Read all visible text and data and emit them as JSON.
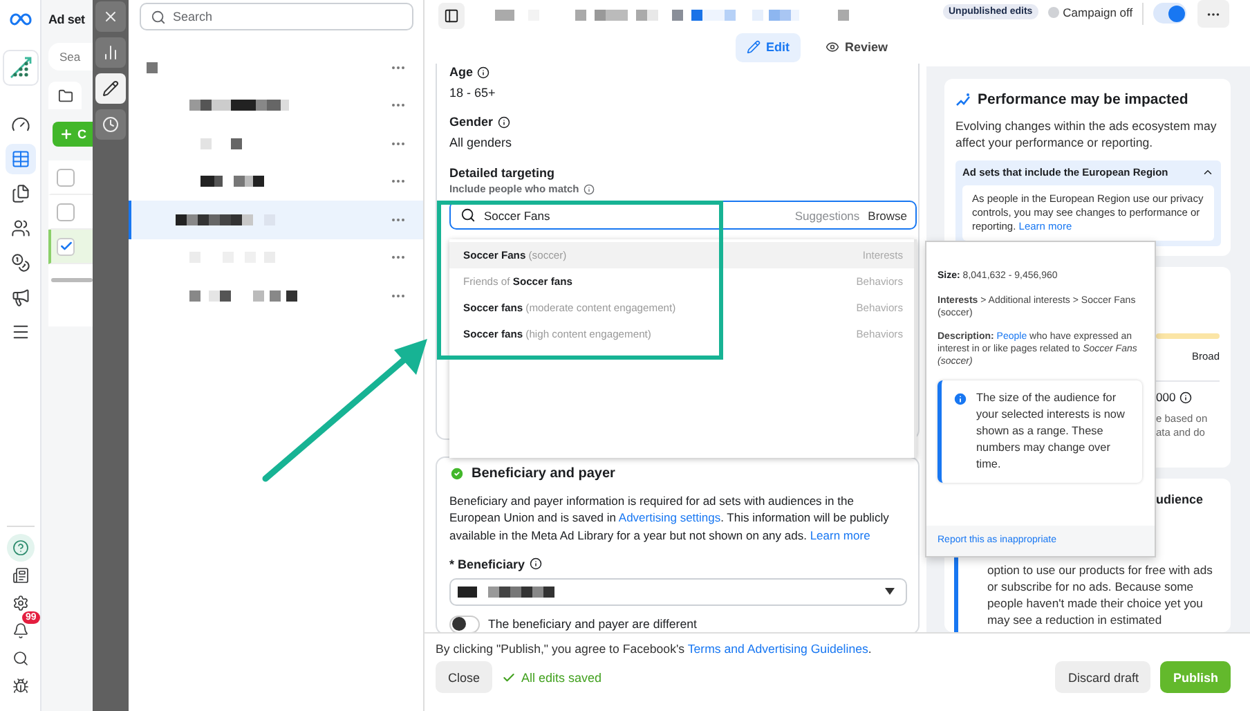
{
  "nav_rail": {
    "top": [
      {
        "kind": "logo",
        "selected": false
      },
      {
        "kind": "app",
        "selected": false
      },
      {
        "kind": "gauge",
        "selected": false
      },
      {
        "kind": "table",
        "selected": true
      },
      {
        "kind": "pages",
        "selected": false
      },
      {
        "kind": "people",
        "selected": false
      },
      {
        "kind": "coins",
        "selected": false
      },
      {
        "kind": "megaphone",
        "selected": false
      },
      {
        "kind": "menu",
        "selected": false
      }
    ],
    "bottom": [
      {
        "kind": "help",
        "selected": false
      },
      {
        "kind": "news",
        "selected": false
      },
      {
        "kind": "settings",
        "selected": false
      },
      {
        "kind": "bell",
        "selected": false,
        "badge": "99"
      },
      {
        "kind": "search",
        "selected": false
      },
      {
        "kind": "bug",
        "selected": false
      }
    ]
  },
  "ad_sets_panel": {
    "title": "Ad set",
    "search_placeholder": "Sea",
    "create_button": "C",
    "rows": [
      {
        "checked": false
      },
      {
        "checked": false
      },
      {
        "checked": true
      }
    ]
  },
  "tool_strip": [
    {
      "kind": "close",
      "selected": false
    },
    {
      "kind": "chart",
      "selected": false
    },
    {
      "kind": "edit",
      "selected": true
    },
    {
      "kind": "history",
      "selected": false
    }
  ],
  "tree": {
    "search_placeholder": "Search",
    "rows": [
      {
        "selected": false
      },
      {
        "selected": false
      },
      {
        "selected": false
      },
      {
        "selected": false
      },
      {
        "selected": true
      },
      {
        "selected": false
      },
      {
        "selected": false
      }
    ]
  },
  "editor": {
    "tabs": [
      {
        "label": "Edit",
        "selected": true
      },
      {
        "label": "Review",
        "selected": false
      }
    ],
    "age": {
      "label": "Age",
      "value": "18 - 65+"
    },
    "gender": {
      "label": "Gender",
      "value": "All genders"
    },
    "detailed_targeting": {
      "label": "Detailed targeting",
      "sublabel": "Include people who match",
      "search_value": "Soccer Fans",
      "suggestions_label": "Suggestions",
      "browse_label": "Browse"
    },
    "suggestions": [
      {
        "text": "**Soccer Fans** (soccer)",
        "category": "Interests",
        "selected": true
      },
      {
        "text": "Friends of **Soccer fans**",
        "category": "Behaviors",
        "selected": false
      },
      {
        "text": "**Soccer fans** (moderate content engagement)",
        "category": "Behaviors",
        "selected": false
      },
      {
        "text": "**Soccer fans** (high content engagement)",
        "category": "Behaviors",
        "selected": false
      }
    ],
    "beneficiary_section": {
      "title": "Beneficiary and payer",
      "description": [
        {
          "kind": "text",
          "text": "Beneficiary and payer information is required for ad sets with audiences in the European Union and is saved in "
        },
        {
          "kind": "link",
          "text": "Advertising settings"
        },
        {
          "kind": "text",
          "text": ". This information will be publicly available in the Meta Ad Library for a year but not shown on any ads. "
        },
        {
          "kind": "link",
          "text": "Learn more"
        }
      ],
      "beneficiary_label": "* Beneficiary",
      "payer_toggle": {
        "label": "The beneficiary and payer are different",
        "on": false
      }
    }
  },
  "header_status": {
    "badge": "Unpublished edits",
    "campaign_status": "Campaign off",
    "campaign_toggle_on": true
  },
  "right_panel": {
    "performance_card": {
      "title": "Performance may be impacted",
      "body": "Evolving changes within the ads ecosystem may affect your performance or reporting.",
      "accordion": {
        "title": "Ad sets that include the European Region",
        "expanded": true,
        "body": "As people in the European Region use our privacy controls, you may see changes to performance or reporting. ",
        "link": "Learn more"
      }
    },
    "audience_card": {
      "range_end": "Broad",
      "estimate": "000",
      "note_lines": [
        "e based on",
        "ata and do"
      ]
    },
    "third_card": {
      "title": "udience",
      "note": "option to use our products for free with ads or subscribe for no ads. Because some people haven't made their choice yet you may see a reduction in estimated"
    }
  },
  "tooltip": {
    "size_label": "Size:",
    "size_value": "8,041,632 - 9,456,960",
    "path": "**Interests** > Additional interests > Soccer Fans (soccer)",
    "description": [
      {
        "kind": "text",
        "text": "**Description:** "
      },
      {
        "kind": "link",
        "text": "People"
      },
      {
        "kind": "text",
        "text": " who have expressed an interest in or like pages related to *Soccer Fans (soccer)*"
      }
    ],
    "info": "The size of the audience for your selected interests is now shown as a range. These numbers may change over time.",
    "report_link": "Report this as inappropriate"
  },
  "footer": {
    "consent": [
      {
        "kind": "text",
        "text": "By clicking \"Publish,\" you agree to Facebook's "
      },
      {
        "kind": "link",
        "text": "Terms and Advertising Guidelines"
      },
      {
        "kind": "text",
        "text": "."
      }
    ],
    "close_button": "Close",
    "saved_status": "All edits saved",
    "discard_button": "Discard draft",
    "publish_button": "Publish"
  }
}
